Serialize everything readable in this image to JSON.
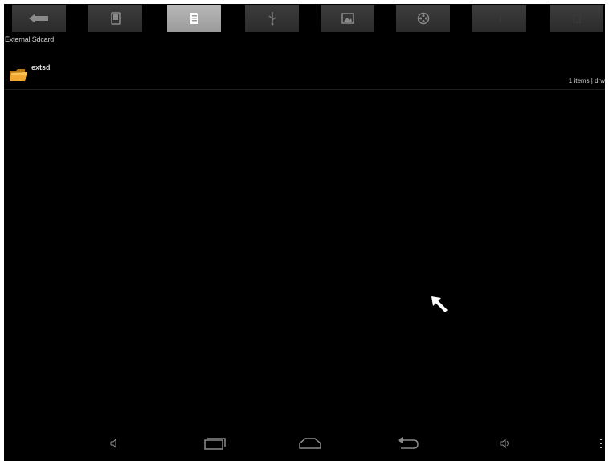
{
  "toolbar": {
    "buttons": [
      {
        "icon": "back-arrow-icon",
        "active": false
      },
      {
        "icon": "phone-storage-icon",
        "active": false
      },
      {
        "icon": "sdcard-icon",
        "active": true
      },
      {
        "icon": "usb-icon",
        "active": false
      },
      {
        "icon": "image-icon",
        "active": false
      },
      {
        "icon": "video-reel-icon",
        "active": false
      },
      {
        "icon": "music-icon",
        "active": false
      },
      {
        "icon": "clipboard-icon",
        "active": false
      }
    ]
  },
  "breadcrumb": {
    "path": "External Sdcard"
  },
  "files": [
    {
      "name": "extsd",
      "meta": "1 items | drw"
    }
  ],
  "navbar": {
    "buttons": [
      "volume-down-icon",
      "recent-apps-icon",
      "home-icon",
      "back-icon",
      "volume-up-icon",
      "overflow-menu-icon"
    ]
  },
  "colors": {
    "background": "#000000",
    "toolbar_button": "#333333",
    "toolbar_button_active": "#a8a8a8",
    "folder": "#e8a020",
    "text": "#d0d0d0"
  }
}
